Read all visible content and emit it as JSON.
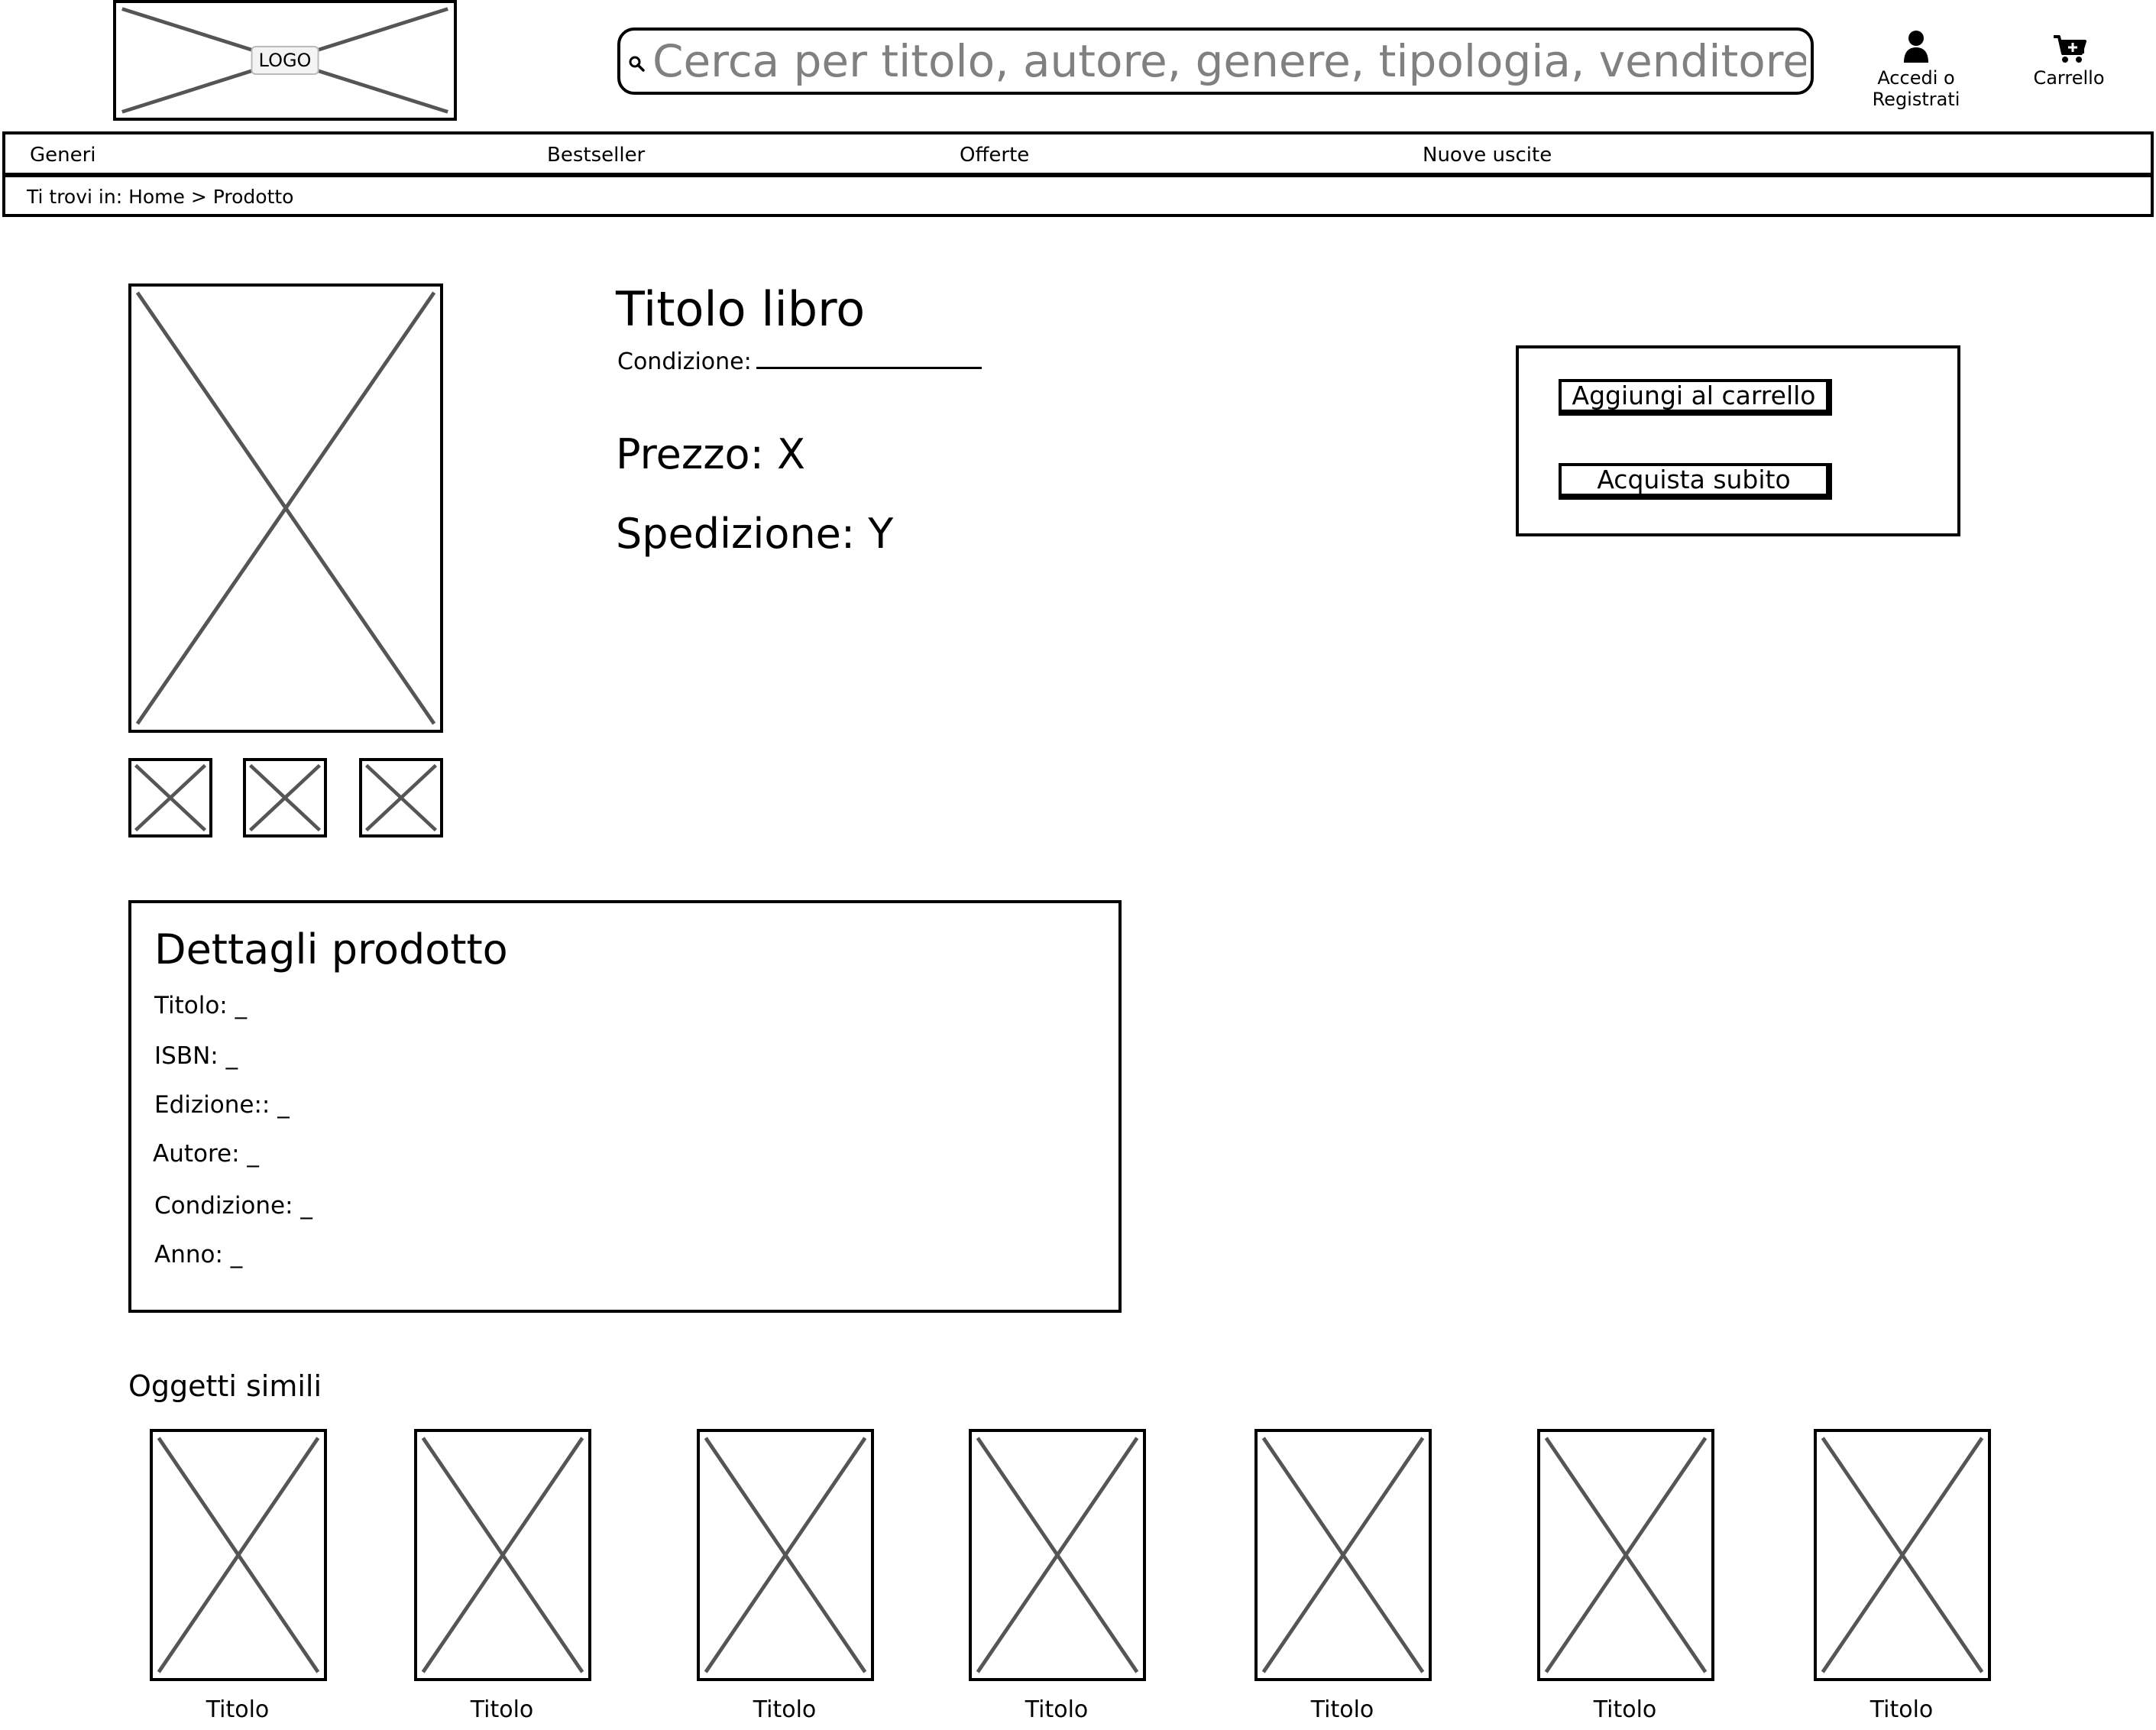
{
  "header": {
    "logo_label": "LOGO",
    "search_placeholder": "Cerca per titolo, autore, genere, tipologia, venditore...",
    "account_label": "Accedi o Registrati",
    "cart_label": "Carrello"
  },
  "nav": {
    "items": [
      "Generi",
      "Bestseller",
      "Offerte",
      "Nuove uscite"
    ]
  },
  "breadcrumb": "Ti trovi in: Home > Prodotto",
  "product": {
    "title": "Titolo libro",
    "condition_label": "Condizione:",
    "price": "Prezzo: X",
    "shipping": "Spedizione: Y",
    "add_to_cart": "Aggiungi al carrello",
    "buy_now": "Acquista subito"
  },
  "details": {
    "heading": "Dettagli prodotto",
    "rows": [
      "Titolo: _",
      "ISBN: _",
      "Edizione:: _",
      "Autore: _",
      "Condizione: _",
      "Anno: _"
    ]
  },
  "similar": {
    "heading": "Oggetti simili",
    "items": [
      "Titolo",
      "Titolo",
      "Titolo",
      "Titolo",
      "Titolo",
      "Titolo",
      "Titolo"
    ]
  },
  "icons": {
    "search": "search-icon",
    "account": "user-icon",
    "cart": "cart-icon",
    "placeholder": "image-placeholder-icon"
  }
}
